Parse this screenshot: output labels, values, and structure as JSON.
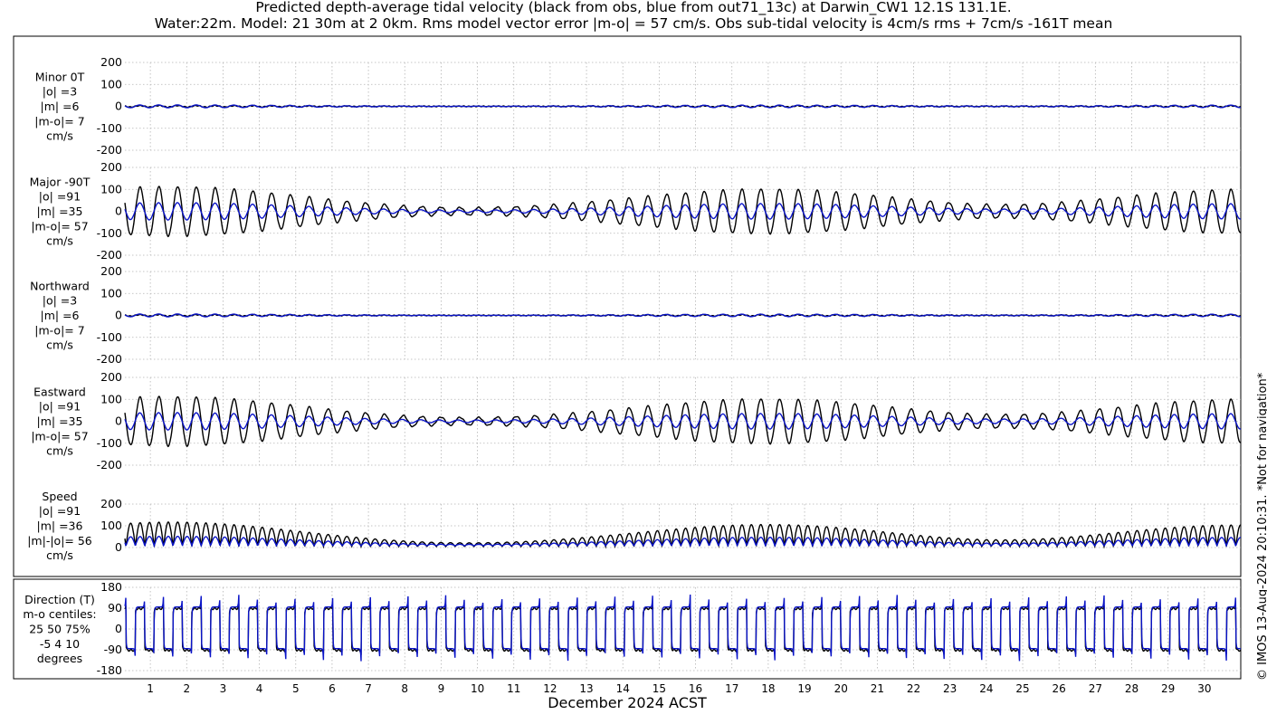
{
  "title_line1": "Predicted depth-average tidal velocity (black from obs, blue from out71_13c) at Darwin_CW1 12.1S 131.1E.",
  "title_line2": "Water:22m. Model: 21 30m at 2 0km. Rms model vector error |m-o| = 57 cm/s. Obs sub-tidal velocity is 4cm/s rms + 7cm/s -161T mean",
  "credit": "© IMOS 13-Aug-2024 20:10:31. *Not for navigation*",
  "colors": {
    "obs": "#000000",
    "model": "#0a14c8",
    "grid": "#b4b4b4"
  },
  "chart_data": {
    "type": "line",
    "xlabel": "December 2024 ACST",
    "x_ticks": [
      "1",
      "2",
      "3",
      "4",
      "5",
      "6",
      "7",
      "8",
      "9",
      "10",
      "11",
      "12",
      "13",
      "14",
      "15",
      "16",
      "17",
      "18",
      "19",
      "20",
      "21",
      "22",
      "23",
      "24",
      "25",
      "26",
      "27",
      "28",
      "29",
      "30"
    ],
    "xlim_days": [
      0.3,
      31.0
    ],
    "series_legend": {
      "obs": "black from obs",
      "model": "blue from out71_13c"
    },
    "panels": [
      {
        "id": "minor",
        "label_lines": [
          "Minor 0T",
          "|o| =3",
          "|m| =6",
          "|m-o|= 7",
          "cm/s"
        ],
        "ylim": [
          -200,
          200
        ],
        "yticks": [
          -200,
          -100,
          0,
          100,
          200
        ],
        "obs_amplitude": 4,
        "model_amplitude": 8,
        "signal": "component"
      },
      {
        "id": "major",
        "label_lines": [
          "Major -90T",
          "|o| =91",
          "|m| =35",
          "|m-o|= 57",
          "cm/s"
        ],
        "ylim": [
          -200,
          200
        ],
        "yticks": [
          -200,
          -100,
          0,
          100,
          200
        ],
        "obs_amplitude": 130,
        "model_amplitude": 50,
        "signal": "component"
      },
      {
        "id": "northward",
        "label_lines": [
          "Northward",
          "|o| =3",
          "|m| =6",
          "|m-o|= 7",
          "cm/s"
        ],
        "ylim": [
          -200,
          200
        ],
        "yticks": [
          -200,
          -100,
          0,
          100,
          200
        ],
        "obs_amplitude": 4,
        "model_amplitude": 8,
        "signal": "component"
      },
      {
        "id": "eastward",
        "label_lines": [
          "Eastward",
          "|o| =91",
          "|m| =35",
          "|m-o|= 57",
          "cm/s"
        ],
        "ylim": [
          -200,
          200
        ],
        "yticks": [
          -200,
          -100,
          0,
          100,
          200
        ],
        "obs_amplitude": 130,
        "model_amplitude": 50,
        "signal": "component"
      },
      {
        "id": "speed",
        "label_lines": [
          "Speed",
          "|o| =91",
          "|m| =36",
          "|m|-|o|= 56",
          "cm/s"
        ],
        "ylim": [
          0,
          200
        ],
        "yticks": [
          0,
          100,
          200
        ],
        "obs_amplitude": 130,
        "model_amplitude": 50,
        "signal": "speed"
      },
      {
        "id": "direction",
        "label_lines": [
          "Direction (T)",
          "m-o centiles:",
          "25  50  75%",
          "-5  4 10",
          "degrees"
        ],
        "ylim": [
          -180,
          180
        ],
        "yticks": [
          -180,
          -90,
          0,
          90,
          180
        ],
        "signal": "direction"
      }
    ]
  }
}
